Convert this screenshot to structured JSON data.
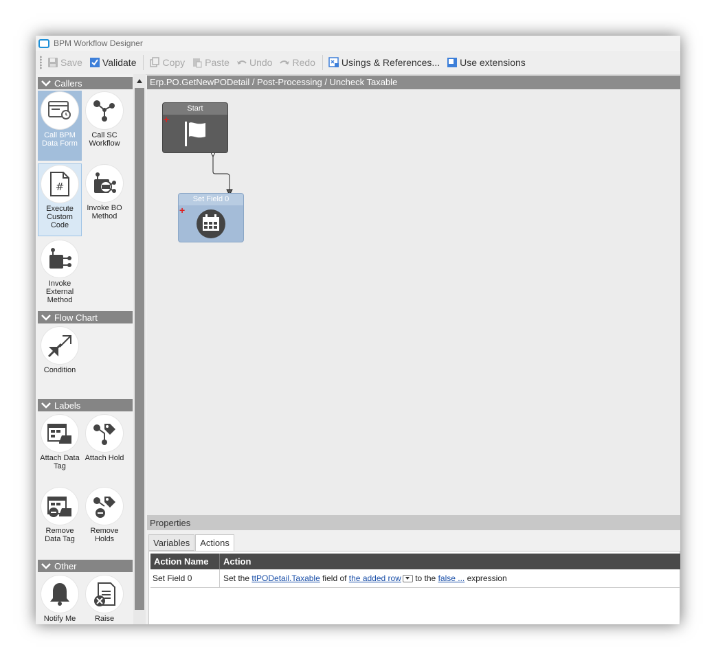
{
  "window": {
    "title": "BPM Workflow Designer"
  },
  "toolbar": {
    "save": "Save",
    "validate": "Validate",
    "copy": "Copy",
    "paste": "Paste",
    "undo": "Undo",
    "redo": "Redo",
    "usings": "Usings & References...",
    "use_extensions": "Use extensions"
  },
  "sidebar": {
    "callers": {
      "title": "Callers",
      "items": [
        "Call BPM Data Form",
        "Call SC Workflow",
        "Execute Custom Code",
        "Invoke BO Method",
        "Invoke External Method"
      ]
    },
    "flow_chart": {
      "title": "Flow Chart",
      "items": [
        "Condition"
      ]
    },
    "labels": {
      "title": "Labels",
      "items": [
        "Attach Data Tag",
        "Attach Hold",
        "Remove Data Tag",
        "Remove Holds"
      ]
    },
    "other": {
      "title": "Other",
      "items": [
        "Notify Me",
        "Raise"
      ]
    }
  },
  "canvas": {
    "breadcrumb": "Erp.PO.GetNewPODetail / Post-Processing / Uncheck Taxable",
    "nodes": {
      "start": "Start",
      "set_field": "Set Field 0"
    }
  },
  "properties": {
    "title": "Properties",
    "tabs": [
      "Variables",
      "Actions"
    ],
    "active_tab": "Actions",
    "columns": [
      "Action Name",
      "Action"
    ],
    "row": {
      "name": "Set Field 0",
      "t1": "Set the ",
      "field": "ttPODetail.Taxable",
      "t2": " field of ",
      "target": "the added row",
      "t3": " to the ",
      "expression": " false ...",
      "t4": " expression"
    }
  },
  "colors": {
    "selected_tool": "#a2bedb",
    "section_header": "#858585",
    "node_start": "#5c5c5c",
    "node_setfield": "#a4bcd8"
  }
}
